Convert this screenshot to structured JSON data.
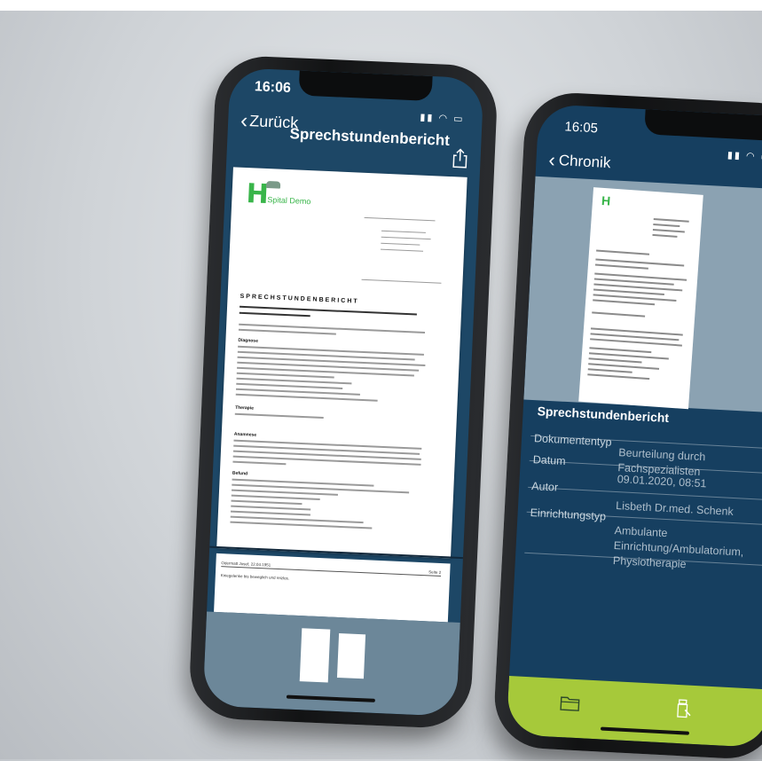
{
  "left_phone": {
    "status_time": "16:06",
    "nav_back_label": "Zurück",
    "nav_title": "Sprechstundenbericht",
    "share_icon": "share-icon",
    "document": {
      "logo_letter": "H",
      "logo_name": "Spital Demo",
      "heading": "SPRECHSTUNDENBERICHT",
      "sections": [
        "Diagnose",
        "Therapie",
        "Anamnese",
        "Befund"
      ]
    },
    "page2_footer_left": "Odermatt Josef, 22.04.1951",
    "page2_footer_right": "Seite 2",
    "page2_text": "Kniegelenke bis beweglich und reizlos."
  },
  "right_phone": {
    "status_time": "16:05",
    "nav_back_label": "Chronik",
    "share_icon": "share-icon",
    "thumb_logo_letter": "H",
    "section_title": "Sprechstundenbericht",
    "rows": [
      {
        "label": "Dokumententyp",
        "value": "Beurteilung durch Fachspezialisten"
      },
      {
        "label": "Datum",
        "value": "09.01.2020, 08:51"
      },
      {
        "label": "Autor",
        "value": "Lisbeth Dr.med. Schenk"
      },
      {
        "label": "Einrichtungstyp",
        "value": "Ambulante Einrichtung/Ambulatorium, Physiotherapie"
      }
    ],
    "tabbar": {
      "left_icon": "folder-icon",
      "right_icon": "medication-icon"
    },
    "colors": {
      "tabbar": "#a6c93a",
      "screen": "#163f60"
    }
  }
}
